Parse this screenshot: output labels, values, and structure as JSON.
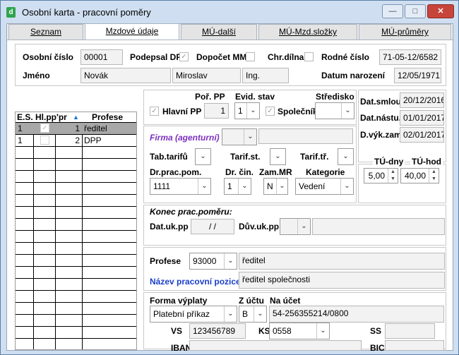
{
  "window": {
    "title": "Osobní karta - pracovní poměry",
    "min": "—",
    "max": "□",
    "close": "✕"
  },
  "tabs": [
    {
      "label": "Seznam"
    },
    {
      "label": "Mzdové údaje"
    },
    {
      "label": "MÚ-další"
    },
    {
      "label": "MÚ-Mzd.složky"
    },
    {
      "label": "MÚ-průměry"
    }
  ],
  "header": {
    "osobni_cislo_label": "Osobní číslo",
    "osobni_cislo": "00001",
    "podepsal_dp_label": "Podepsal DP",
    "dopocet_mm_label": "Dopočet MM",
    "chr_dilna_label": "Chr.dílna",
    "rodne_cislo_label": "Rodné číslo",
    "rodne_cislo": "71-05-12/6582",
    "jmeno_label": "Jméno",
    "prijmeni": "Novák",
    "jmeno": "Miroslav",
    "titul": "Ing.",
    "datum_narozeni_label": "Datum narození",
    "datum_narozeni": "12/05/1971"
  },
  "grid": {
    "columns": [
      "E.S.",
      "Hl.pp",
      "Pořadí",
      "Profese"
    ],
    "col3_short": "'pr",
    "rows": [
      {
        "es": "1",
        "hl": "✓",
        "por": "1",
        "profese": "ředitel"
      },
      {
        "es": "1",
        "hl": "",
        "por": "2",
        "profese": "DPP"
      }
    ]
  },
  "detail": {
    "por_pp_label": "Poř. PP",
    "por_pp": "1",
    "hlavni_pp_label": "Hlavní PP",
    "evid_stav_label": "Evid. stav",
    "evid_stav": "1",
    "spolecnik_label": "Společník",
    "stredisko_label": "Středisko",
    "stredisko": "",
    "dat_smlou_label": "Dat.smlou.",
    "dat_smlou": "20/12/2016",
    "dat_nastu_label": "Dat.nástu.",
    "dat_nastu": "01/01/2017",
    "d_vyk_zam_label": "D.výk.zam.",
    "d_vyk_zam": "02/01/2017",
    "firma_label": "Firma (agenturní)",
    "firma": "",
    "tab_tarifu_label": "Tab.tarifů",
    "tarif_st_label": "Tarif.st.",
    "tarif_tr_label": "Tarif.tř.",
    "tu_dny_label": "TÚ-dny",
    "tu_dny": "5,00",
    "tu_hod_label": "TÚ-hod",
    "tu_hod": "40,00",
    "dr_prac_pom_label": "Dr.prac.pom.",
    "dr_prac_pom": "1111",
    "dr_cin_label": "Dr. čin.",
    "dr_cin": "1",
    "zam_mr_label": "Zam.MR",
    "zam_mr": "N",
    "kategorie_label": "Kategorie",
    "kategorie": "Vedení",
    "konec_label": "Konec prac.poměru:",
    "dat_uk_pp_label": "Dat.uk.pp",
    "dat_uk_pp": "/ /",
    "duv_uk_pp_label": "Dův.uk.pp",
    "duv_uk_pp": "",
    "profese_label": "Profese",
    "profese_kod": "93000",
    "profese_nazev": "ředitel",
    "nazev_pozice_label": "Název pracovní pozice",
    "nazev_pozice": "ředitel společnosti",
    "forma_vyplaty_label": "Forma výplaty",
    "forma_vyplaty": "Platební příkaz",
    "z_uctu_label": "Z účtu",
    "z_uctu": "B",
    "na_ucet_label": "Na účet",
    "na_ucet": "54-256355214/0800",
    "vs_label": "VS",
    "vs": "123456789",
    "ks_label": "KS",
    "ks": "0558",
    "ss_label": "SS",
    "ss": "",
    "iban_label": "IBAN",
    "iban": "",
    "bic_label": "BIC",
    "bic": ""
  },
  "icons": {
    "checked": "✓",
    "dropdown": "⌄",
    "up": "▲",
    "down": "▼",
    "sort": "▲"
  }
}
